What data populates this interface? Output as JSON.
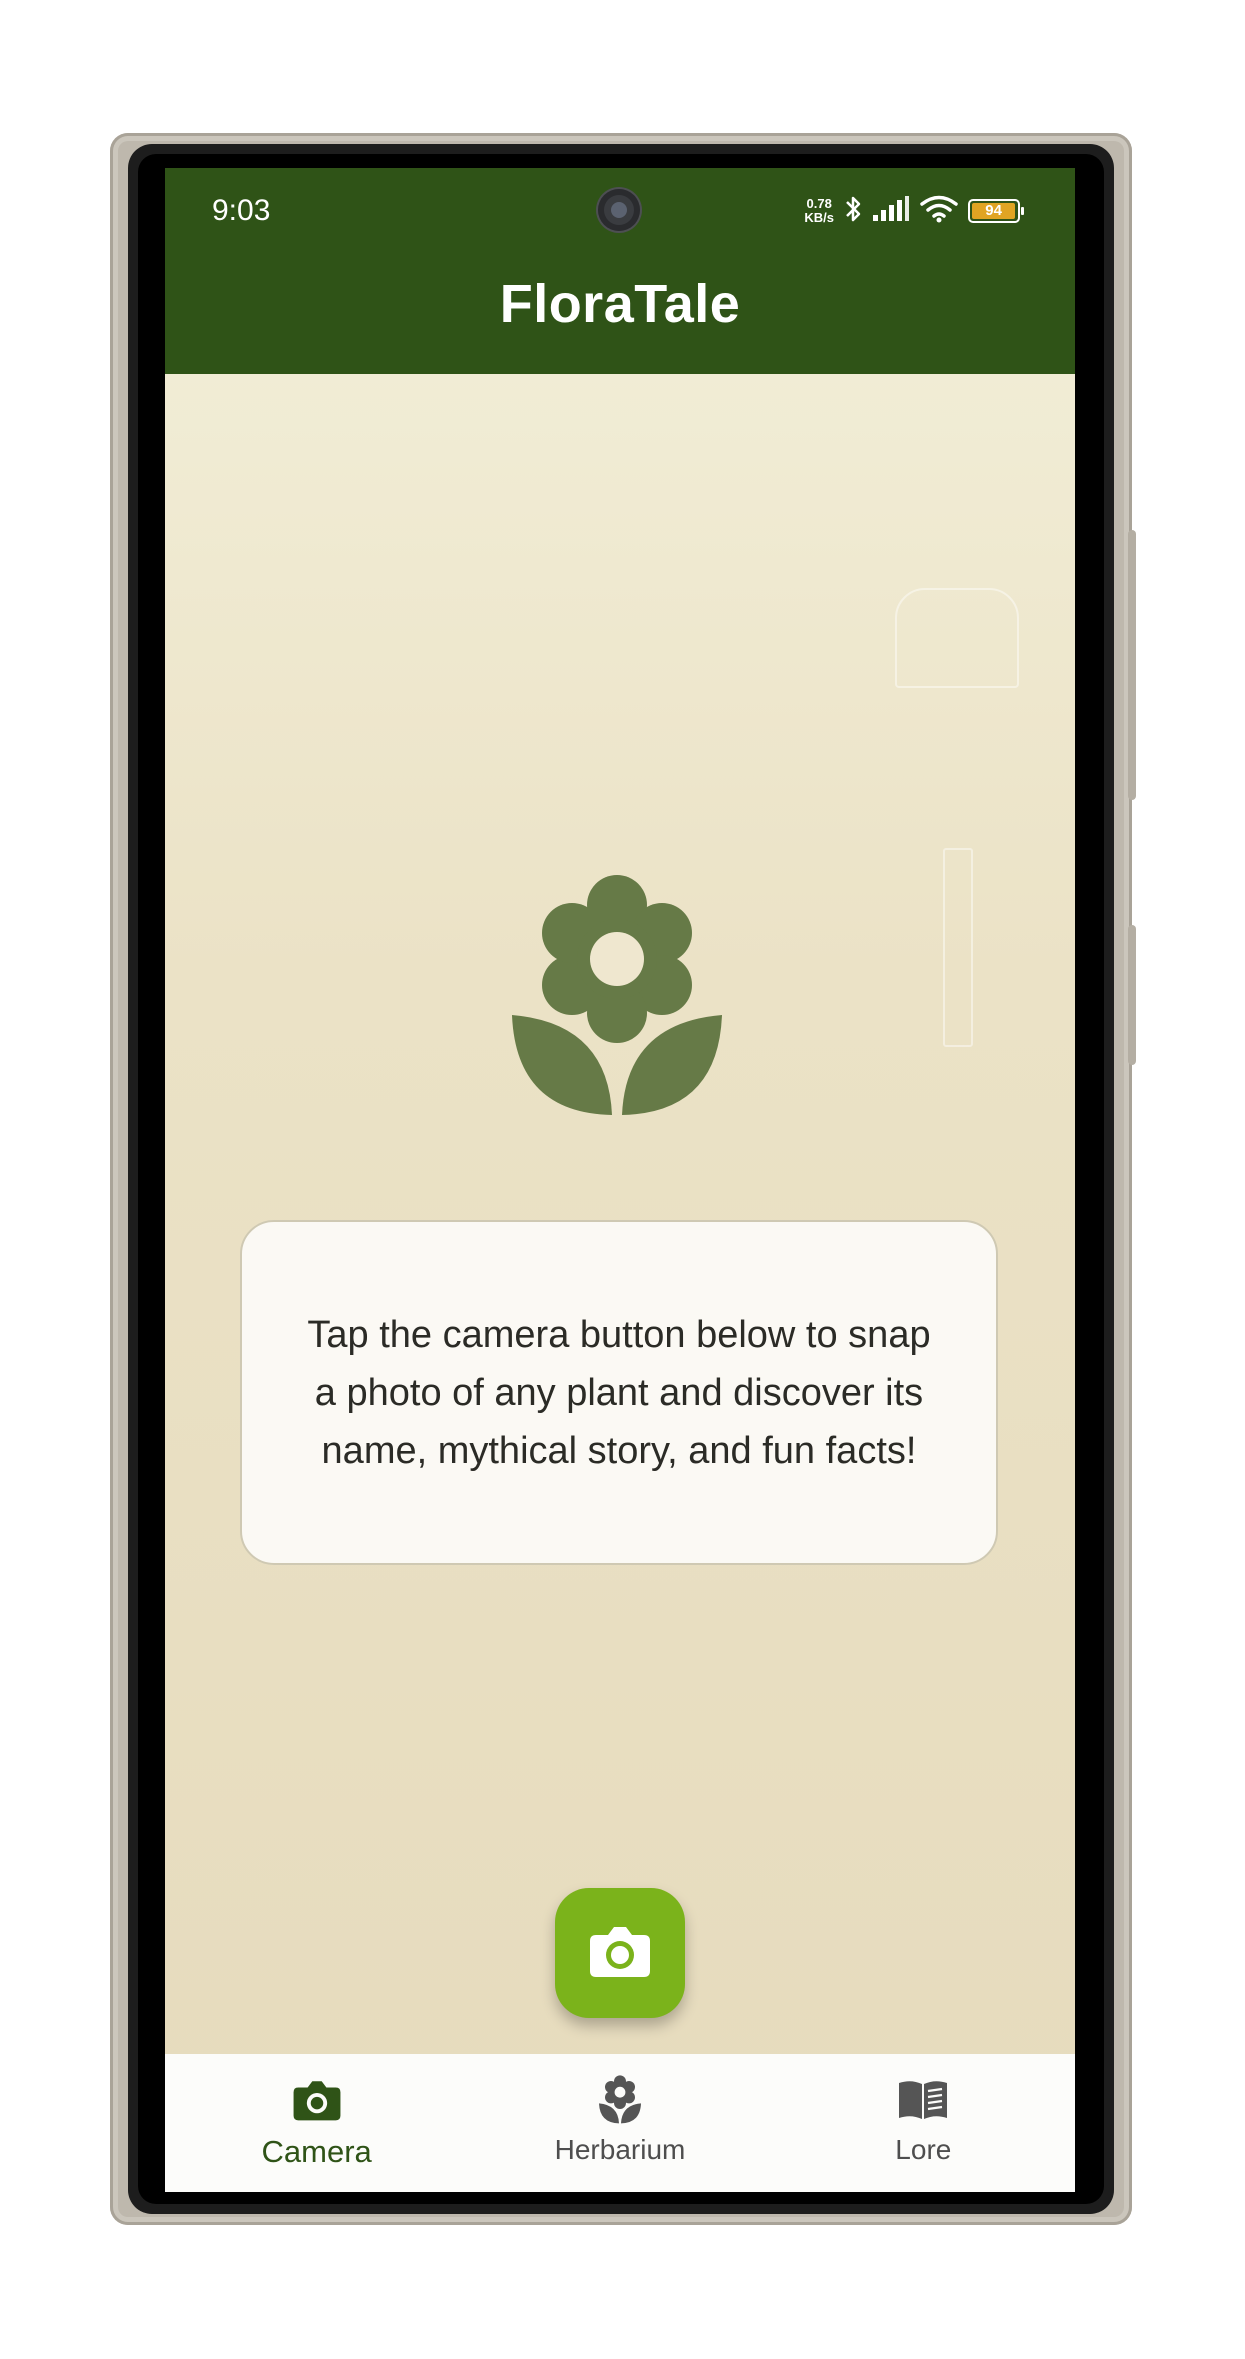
{
  "status_bar": {
    "time": "9:03",
    "net_speed_value": "0.78",
    "net_speed_unit": "KB/s",
    "battery_level": "94",
    "icons": [
      "bluetooth-icon",
      "signal-icon",
      "wifi-icon",
      "battery-icon"
    ]
  },
  "app_bar": {
    "title": "FloraTale"
  },
  "main": {
    "hero_icon": "flower-icon",
    "info_text": "Tap the camera button below to snap a photo of any plant and discover its name, mythical story, and fun facts!",
    "fab_icon": "camera-icon"
  },
  "bottom_nav": {
    "items": [
      {
        "label": "Camera",
        "icon": "camera-icon",
        "active": true
      },
      {
        "label": "Herbarium",
        "icon": "flower-icon",
        "active": false
      },
      {
        "label": "Lore",
        "icon": "book-icon",
        "active": false
      }
    ]
  },
  "colors": {
    "app_bar": "#2f5317",
    "accent": "#7bb31b",
    "icon_green": "#667a47",
    "background": "#ebe2c6"
  }
}
